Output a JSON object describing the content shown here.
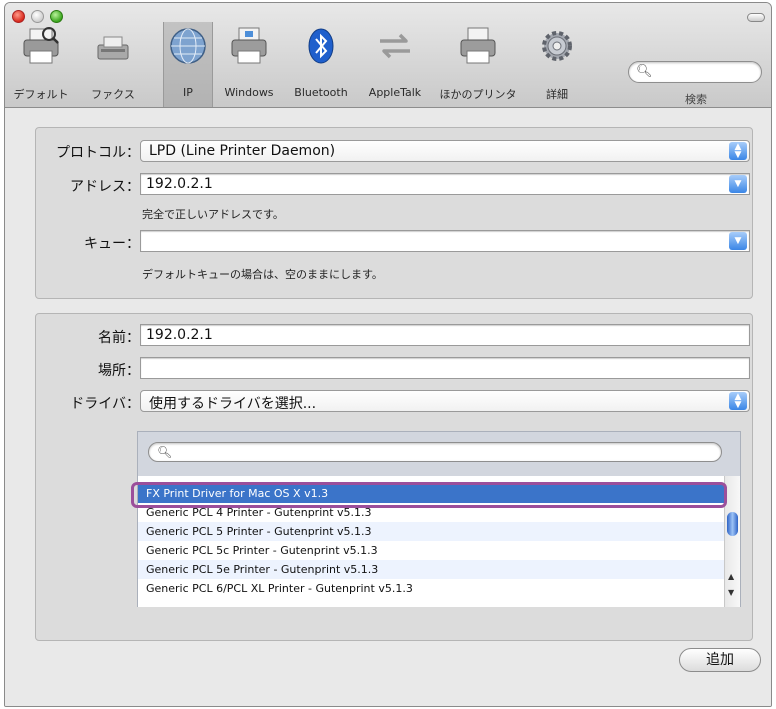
{
  "toolbar": {
    "items": [
      {
        "label": "デフォルト",
        "icon": "default-printer-icon"
      },
      {
        "label": "ファクス",
        "icon": "fax-icon"
      },
      {
        "label": "IP",
        "icon": "globe-icon"
      },
      {
        "label": "Windows",
        "icon": "windows-printer-icon"
      },
      {
        "label": "Bluetooth",
        "icon": "bluetooth-icon"
      },
      {
        "label": "AppleTalk",
        "icon": "appletalk-icon"
      },
      {
        "label": "ほかのプリンタ",
        "icon": "other-printer-icon"
      },
      {
        "label": "詳細",
        "icon": "gear-icon"
      }
    ],
    "selected": "IP",
    "search_placeholder": "",
    "search_caption": "検索"
  },
  "address_group": {
    "protocol_label": "プロトコル：",
    "protocol_value": "LPD (Line Printer Daemon)",
    "address_label": "アドレス：",
    "address_value": "192.0.2.1",
    "address_hint": "完全で正しいアドレスです。",
    "queue_label": "キュー：",
    "queue_value": "",
    "queue_hint": "デフォルトキューの場合は、空のままにします。"
  },
  "printer_group": {
    "name_label": "名前：",
    "name_value": "192.0.2.1",
    "location_label": "場所：",
    "location_value": "",
    "driver_label": "ドライバ：",
    "driver_value": "使用するドライバを選択...",
    "driver_search": "",
    "drivers": [
      "FX Print Driver for Mac OS X v1.3",
      "Generic PCL 4 Printer - Gutenprint v5.1.3",
      "Generic PCL 5 Printer - Gutenprint v5.1.3",
      "Generic PCL 5c Printer - Gutenprint v5.1.3",
      "Generic PCL 5e Printer - Gutenprint v5.1.3",
      "Generic PCL 6/PCL XL Printer - Gutenprint v5.1.3"
    ],
    "selected_driver_index": 0
  },
  "footer": {
    "add_label": "追加"
  },
  "colors": {
    "selection": "#3b74c9",
    "highlight_outline": "#9b4f9b",
    "aqua": "#3b86e6"
  }
}
